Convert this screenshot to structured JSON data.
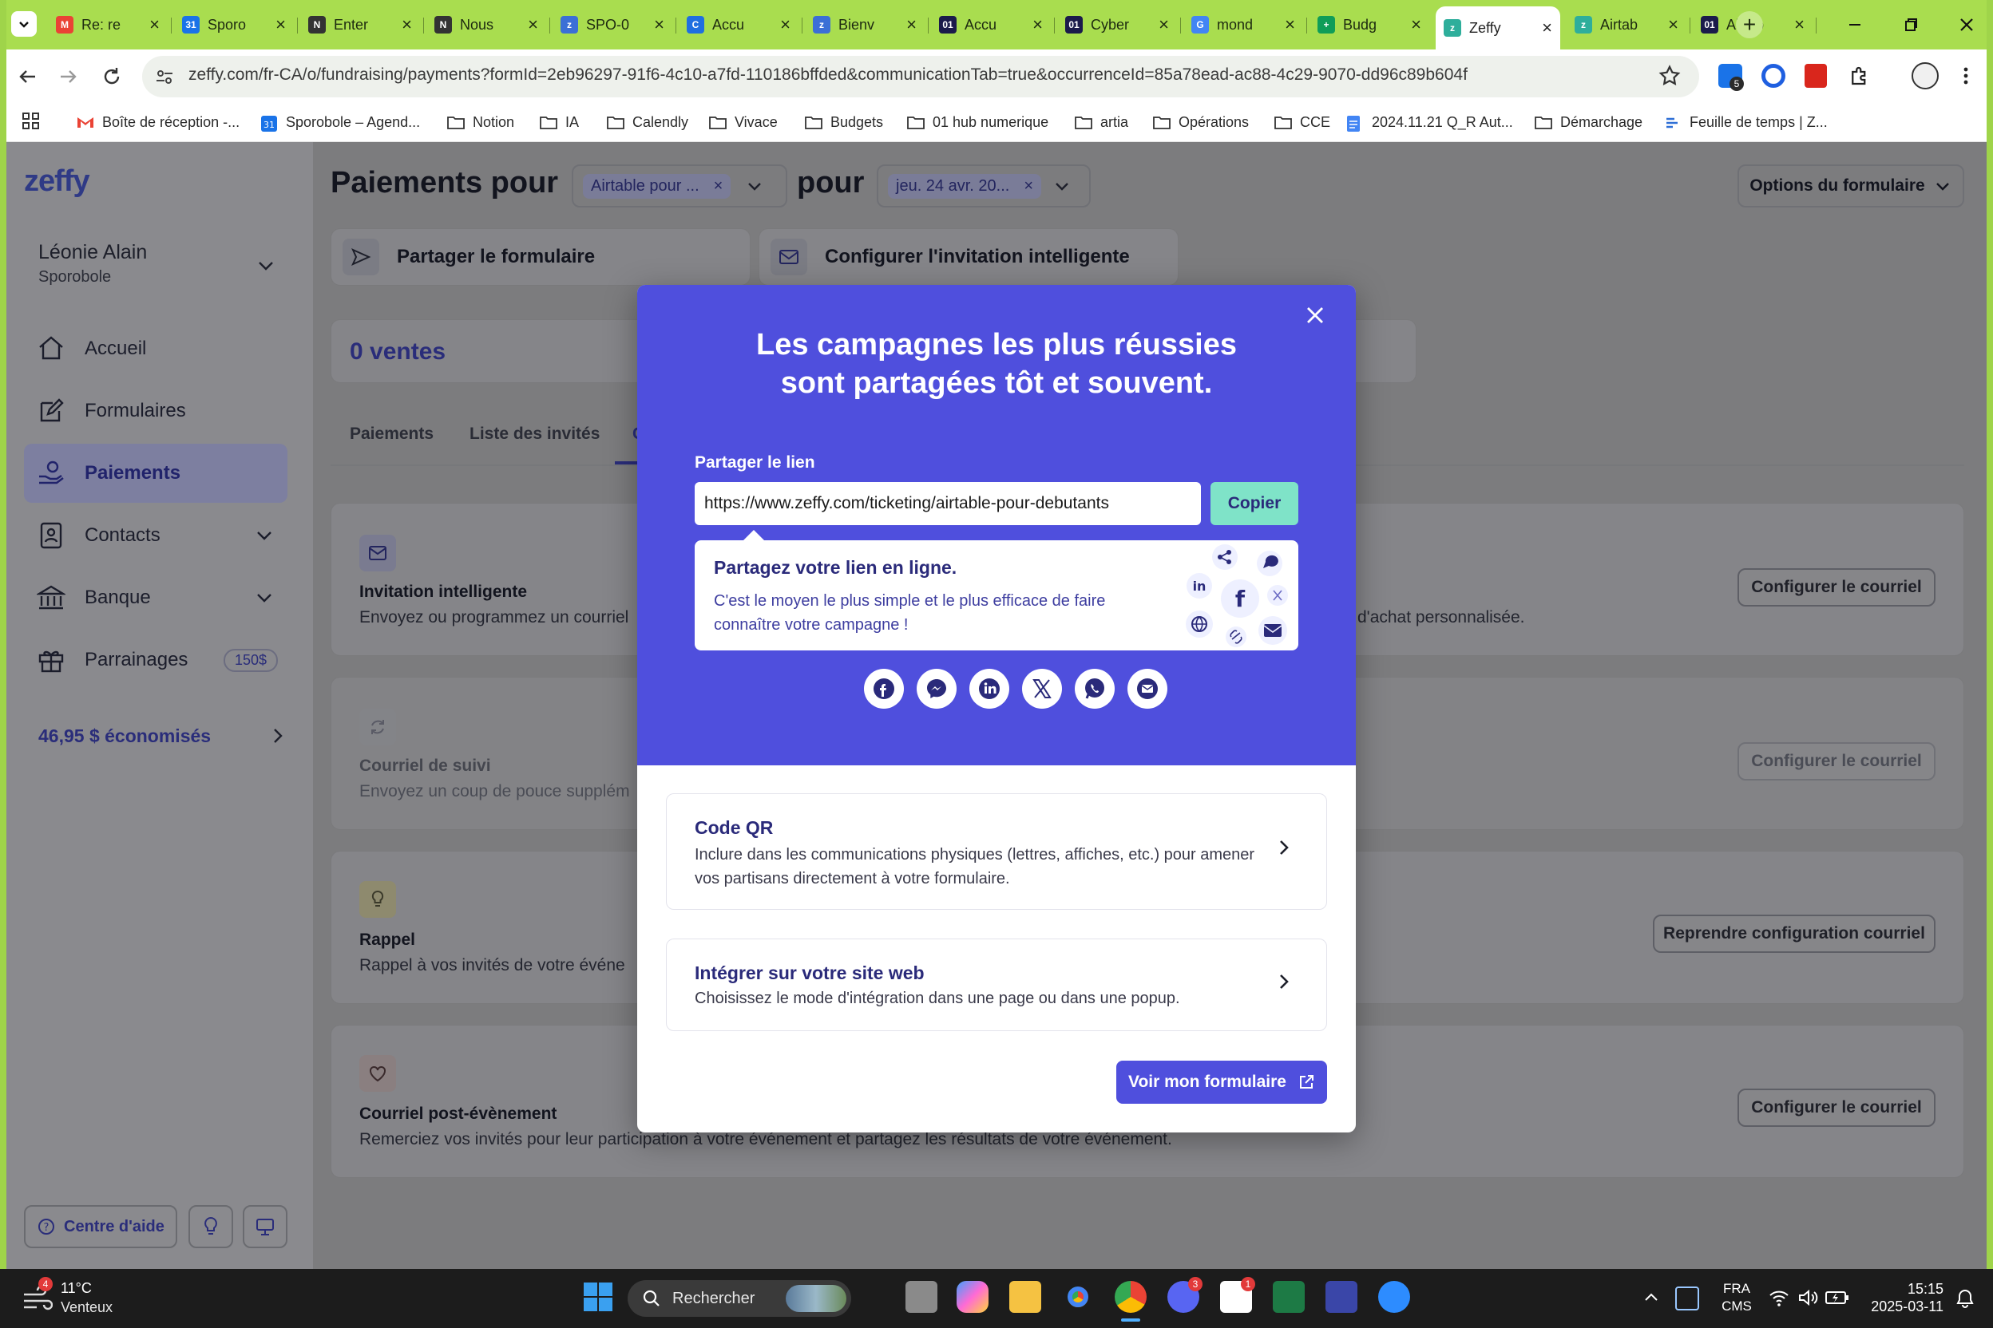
{
  "browser": {
    "tabs": [
      {
        "title": "Re: re",
        "fav": "gmail",
        "color": "#ea4335"
      },
      {
        "title": "Sporo",
        "fav": "calendar",
        "color": "#1a73e8"
      },
      {
        "title": "Enter",
        "fav": "notion",
        "color": "#333333"
      },
      {
        "title": "Nous",
        "fav": "notion",
        "color": "#333333"
      },
      {
        "title": "SPO-0",
        "fav": "zeffy",
        "color": "#3b6fd6"
      },
      {
        "title": "Accu",
        "fav": "canva",
        "color": "#1f6fe0"
      },
      {
        "title": "Bienv",
        "fav": "zeffy",
        "color": "#3b6fd6"
      },
      {
        "title": "Accu",
        "fav": "01",
        "color": "#1b1b4b"
      },
      {
        "title": "Cyber",
        "fav": "01",
        "color": "#1b1b4b"
      },
      {
        "title": "mond",
        "fav": "google",
        "color": "#4285f4"
      },
      {
        "title": "Budg",
        "fav": "sheets",
        "color": "#0f9d58"
      },
      {
        "title": "Zeffy",
        "fav": "zeffy",
        "color": "#2eae9b"
      },
      {
        "title": "Airtab",
        "fav": "zeffy",
        "color": "#2eae9b"
      },
      {
        "title": "Airtab",
        "fav": "01",
        "color": "#1b1b4b"
      }
    ],
    "active_tab_index": 11,
    "url": "zeffy.com/fr-CA/o/fundraising/payments?formId=2eb96297-91f6-4c10-a7fd-110186bffded&communicationTab=true&occurrenceId=85a78ead-ac88-4c29-9070-dd96c89b604f",
    "extension_badge": "5",
    "bookmarks": [
      {
        "label": "Boîte de réception -...",
        "icon": "gmail-icon"
      },
      {
        "label": "Sporobole – Agend...",
        "icon": "calendar-icon"
      },
      {
        "label": "Notion",
        "icon": "folder-icon"
      },
      {
        "label": "IA",
        "icon": "folder-icon"
      },
      {
        "label": "Calendly",
        "icon": "folder-icon"
      },
      {
        "label": "Vivace",
        "icon": "folder-icon"
      },
      {
        "label": "Budgets",
        "icon": "folder-icon"
      },
      {
        "label": "01 hub numerique",
        "icon": "folder-icon"
      },
      {
        "label": "artia",
        "icon": "folder-icon"
      },
      {
        "label": "Opérations",
        "icon": "folder-icon"
      },
      {
        "label": "CCE",
        "icon": "folder-icon"
      },
      {
        "label": "2024.11.21 Q_R Aut...",
        "icon": "docs-icon"
      },
      {
        "label": "Démarchage",
        "icon": "folder-icon"
      },
      {
        "label": "Feuille de temps | Z...",
        "icon": "zeffy-icon"
      }
    ]
  },
  "sidebar": {
    "logo": "zeffy",
    "user_name": "Léonie Alain",
    "org_name": "Sporobole",
    "items": [
      {
        "label": "Accueil",
        "icon": "home-icon"
      },
      {
        "label": "Formulaires",
        "icon": "edit-icon"
      },
      {
        "label": "Paiements",
        "icon": "hand-coin-icon",
        "active": true
      },
      {
        "label": "Contacts",
        "icon": "contacts-icon",
        "chevron": true
      },
      {
        "label": "Banque",
        "icon": "bank-icon",
        "chevron": true
      },
      {
        "label": "Parrainages",
        "icon": "gift-icon",
        "badge": "150$"
      }
    ],
    "savings": "46,95 $ économisés",
    "help": "Centre d'aide"
  },
  "main": {
    "title": "Paiements pour",
    "form_chip": "Airtable pour ...",
    "pour": "pour",
    "date_chip": "jeu. 24 avr. 20...",
    "options_button": "Options du formulaire",
    "share_form": "Partager le formulaire",
    "smart_invite": "Configurer l'invitation intelligente",
    "sales": "0 ventes",
    "tabs": [
      "Paiements",
      "Liste des invités",
      "C"
    ],
    "sections": [
      {
        "title": "Invitation intelligente",
        "desc": "Envoyez ou programmez un courriel",
        "desc_right": "d'achat personnalisée.",
        "button": "Configurer le courriel"
      },
      {
        "title": "Courriel de suivi",
        "desc": "Envoyez un coup de pouce supplém",
        "button": "Configurer le courriel"
      },
      {
        "title": "Rappel",
        "desc": "Rappel à vos invités de votre événe",
        "button": "Reprendre configuration courriel"
      },
      {
        "title": "Courriel post-évènement",
        "desc": "Remerciez vos invités pour leur participation à votre événement et partagez les résultats de votre événement.",
        "button": "Configurer le courriel"
      }
    ]
  },
  "modal": {
    "title": "Les campagnes les plus réussies sont partagées tôt et souvent.",
    "share_link_label": "Partager le lien",
    "link": "https://www.zeffy.com/ticketing/airtable-pour-debutants",
    "copy_button": "Copier",
    "online_title": "Partagez votre lien en ligne.",
    "online_desc": "C'est le moyen le plus simple et le plus efficace de faire connaître votre campagne !",
    "socials": [
      "facebook-icon",
      "messenger-icon",
      "linkedin-icon",
      "x-icon",
      "whatsapp-icon",
      "email-icon"
    ],
    "qr_title": "Code QR",
    "qr_desc": "Inclure dans les communications physiques (lettres, affiches, etc.) pour amener vos partisans directement à votre formulaire.",
    "embed_title": "Intégrer sur votre site web",
    "embed_desc": "Choisissez le mode d'intégration dans une page ou dans une popup.",
    "view_button": "Voir mon formulaire",
    "accent": "#4f4fdd"
  },
  "taskbar": {
    "weather_temp": "11°C",
    "weather_desc": "Venteux",
    "weather_badge": "4",
    "search": "Rechercher",
    "lang1": "FRA",
    "lang2": "CMS",
    "time": "15:15",
    "date": "2025-03-11",
    "badges": {
      "discord": "3",
      "notion": "1"
    }
  }
}
